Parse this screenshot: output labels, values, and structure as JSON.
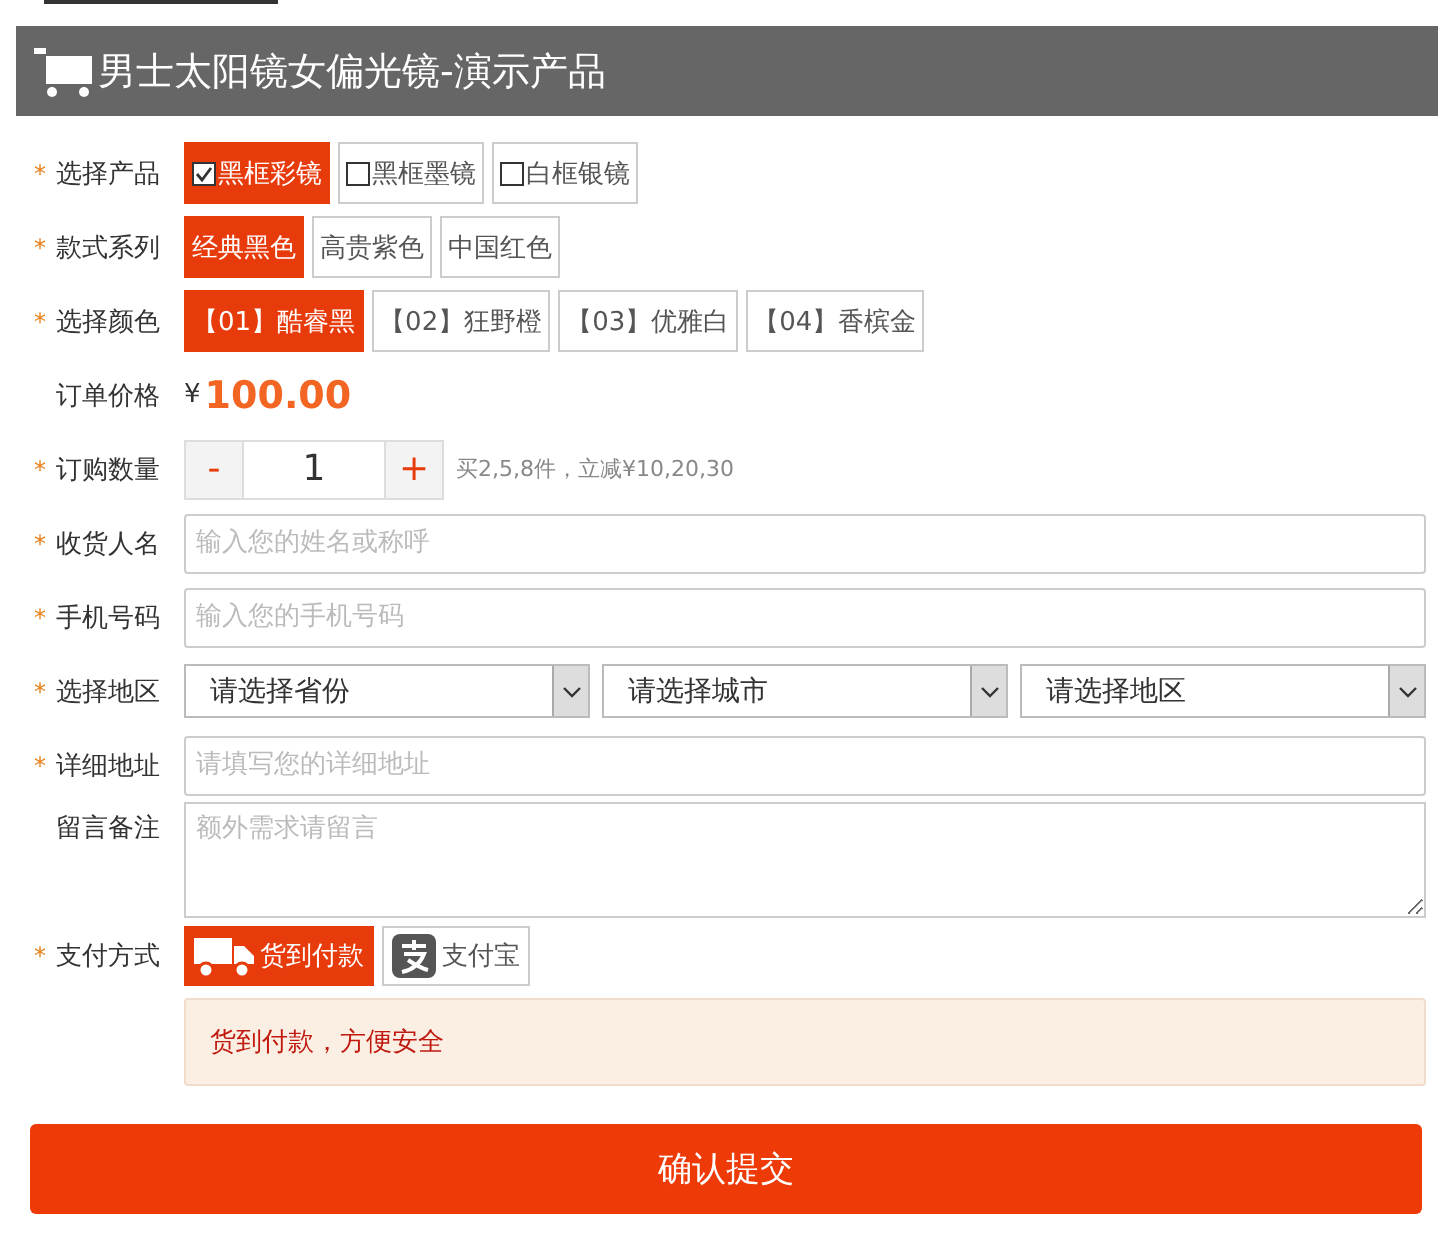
{
  "header": {
    "title": "男士太阳镜女偏光镜-演示产品"
  },
  "fields": [
    {
      "kind": "checks",
      "label": "选择产品",
      "asterisk": "*",
      "options": [
        {
          "label": "黑框彩镜",
          "selected": true
        },
        {
          "label": "黑框墨镜",
          "selected": false
        },
        {
          "label": "白框银镜",
          "selected": false
        }
      ]
    },
    {
      "kind": "choices",
      "label": "款式系列",
      "asterisk": "*",
      "options": [
        {
          "label": "经典黑色",
          "selected": true
        },
        {
          "label": "高贵紫色",
          "selected": false
        },
        {
          "label": "中国红色",
          "selected": false
        }
      ]
    },
    {
      "kind": "choices",
      "label": "选择颜色",
      "asterisk": "*",
      "options": [
        {
          "label": "【01】酷睿黑",
          "selected": true
        },
        {
          "label": "【02】狂野橙",
          "selected": false
        },
        {
          "label": "【03】优雅白",
          "selected": false
        },
        {
          "label": "【04】香槟金",
          "selected": false
        }
      ]
    },
    {
      "kind": "price",
      "label": "订单价格",
      "currency": "¥",
      "amount": "100.00"
    },
    {
      "kind": "quantity",
      "label": "订购数量",
      "asterisk": "*",
      "minus": "-",
      "value": "1",
      "plus": "+",
      "note": "买2,5,8件，立减¥10,20,30"
    },
    {
      "kind": "text",
      "label": "收货人名",
      "asterisk": "*",
      "placeholder": "输入您的姓名或称呼"
    },
    {
      "kind": "text",
      "label": "手机号码",
      "asterisk": "*",
      "placeholder": "输入您的手机号码"
    },
    {
      "kind": "selects",
      "label": "选择地区",
      "asterisk": "*",
      "selects": [
        "请选择省份",
        "请选择城市",
        "请选择地区"
      ]
    },
    {
      "kind": "text",
      "label": "详细地址",
      "asterisk": "*",
      "placeholder": "请填写您的详细地址"
    },
    {
      "kind": "textarea",
      "label": "留言备注",
      "placeholder": "额外需求请留言"
    },
    {
      "kind": "payment",
      "label": "支付方式",
      "asterisk": "*",
      "options": [
        {
          "label": "货到付款",
          "selected": true
        },
        {
          "label": "支付宝",
          "selected": false
        }
      ],
      "note": "货到付款，方便安全"
    }
  ],
  "submit": "确认提交"
}
